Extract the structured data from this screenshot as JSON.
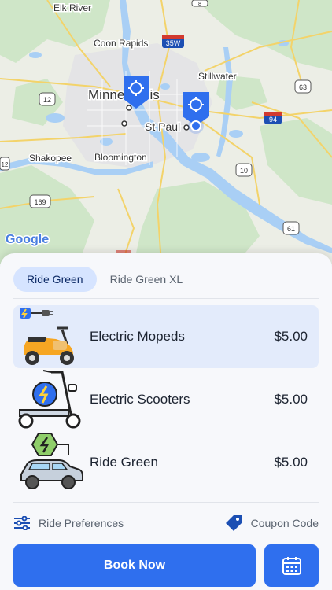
{
  "map": {
    "provider_logo": "Google",
    "places": {
      "elk_river": "Elk River",
      "coon_rapids": "Coon Rapids",
      "minneapolis": "Minneapolis",
      "stillwater": "Stillwater",
      "st_paul": "St Paul",
      "shakopee": "Shakopee",
      "bloomington": "Bloomington"
    },
    "shields": {
      "i35w": "35W",
      "us12": "12",
      "i94": "94",
      "us63": "63",
      "us169": "169",
      "us10": "10",
      "us61": "61",
      "us8": "8",
      "us12b": "12"
    },
    "pin_icon": "crosshair-pin-icon",
    "colors": {
      "pin": "#2f6fee",
      "land": "#e9ede4",
      "park": "#c9e5c5",
      "water": "#a6cdf5"
    }
  },
  "tabs": [
    {
      "label": "Ride Green",
      "active": true
    },
    {
      "label": "Ride Green XL",
      "active": false
    }
  ],
  "rides": [
    {
      "name": "Electric Mopeds",
      "price": "$5.00",
      "selected": true,
      "icon": "electric-moped-icon"
    },
    {
      "name": "Electric Scooters",
      "price": "$5.00",
      "selected": false,
      "icon": "electric-scooter-icon"
    },
    {
      "name": "Ride Green",
      "price": "$5.00",
      "selected": false,
      "icon": "electric-car-icon"
    }
  ],
  "options": {
    "preferences_label": "Ride Preferences",
    "coupon_label": "Coupon Code"
  },
  "book_label": "Book Now",
  "colors": {
    "accent": "#2f6fee",
    "selected_bg": "#e3ebfb",
    "tab_active_bg": "#d6e4ff"
  }
}
